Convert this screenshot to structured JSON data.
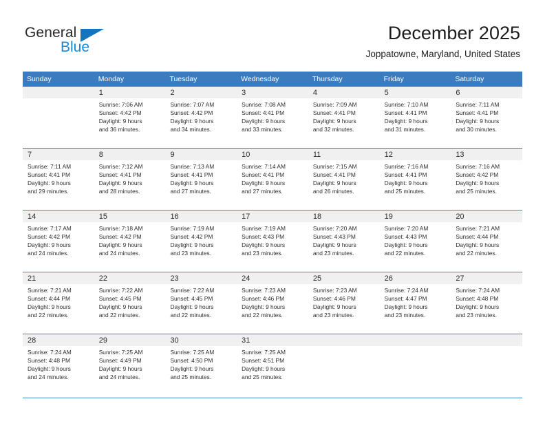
{
  "brand": {
    "name_part1": "General",
    "name_part2": "Blue",
    "triangle_color": "#1574bb",
    "blue_color": "#1b86d6"
  },
  "header": {
    "title": "December 2025",
    "subtitle": "Joppatowne, Maryland, United States"
  },
  "theme": {
    "header_row_bg": "#3b7cc0",
    "day_number_bg": "#f0f0f0",
    "row_divider": "#4a86c5"
  },
  "calendar": {
    "weekdays": [
      "Sunday",
      "Monday",
      "Tuesday",
      "Wednesday",
      "Thursday",
      "Friday",
      "Saturday"
    ],
    "weeks": [
      [
        {
          "day": "",
          "lines": []
        },
        {
          "day": "1",
          "lines": [
            "Sunrise: 7:06 AM",
            "Sunset: 4:42 PM",
            "Daylight: 9 hours",
            "and 36 minutes."
          ]
        },
        {
          "day": "2",
          "lines": [
            "Sunrise: 7:07 AM",
            "Sunset: 4:42 PM",
            "Daylight: 9 hours",
            "and 34 minutes."
          ]
        },
        {
          "day": "3",
          "lines": [
            "Sunrise: 7:08 AM",
            "Sunset: 4:41 PM",
            "Daylight: 9 hours",
            "and 33 minutes."
          ]
        },
        {
          "day": "4",
          "lines": [
            "Sunrise: 7:09 AM",
            "Sunset: 4:41 PM",
            "Daylight: 9 hours",
            "and 32 minutes."
          ]
        },
        {
          "day": "5",
          "lines": [
            "Sunrise: 7:10 AM",
            "Sunset: 4:41 PM",
            "Daylight: 9 hours",
            "and 31 minutes."
          ]
        },
        {
          "day": "6",
          "lines": [
            "Sunrise: 7:11 AM",
            "Sunset: 4:41 PM",
            "Daylight: 9 hours",
            "and 30 minutes."
          ]
        }
      ],
      [
        {
          "day": "7",
          "lines": [
            "Sunrise: 7:11 AM",
            "Sunset: 4:41 PM",
            "Daylight: 9 hours",
            "and 29 minutes."
          ]
        },
        {
          "day": "8",
          "lines": [
            "Sunrise: 7:12 AM",
            "Sunset: 4:41 PM",
            "Daylight: 9 hours",
            "and 28 minutes."
          ]
        },
        {
          "day": "9",
          "lines": [
            "Sunrise: 7:13 AM",
            "Sunset: 4:41 PM",
            "Daylight: 9 hours",
            "and 27 minutes."
          ]
        },
        {
          "day": "10",
          "lines": [
            "Sunrise: 7:14 AM",
            "Sunset: 4:41 PM",
            "Daylight: 9 hours",
            "and 27 minutes."
          ]
        },
        {
          "day": "11",
          "lines": [
            "Sunrise: 7:15 AM",
            "Sunset: 4:41 PM",
            "Daylight: 9 hours",
            "and 26 minutes."
          ]
        },
        {
          "day": "12",
          "lines": [
            "Sunrise: 7:16 AM",
            "Sunset: 4:41 PM",
            "Daylight: 9 hours",
            "and 25 minutes."
          ]
        },
        {
          "day": "13",
          "lines": [
            "Sunrise: 7:16 AM",
            "Sunset: 4:42 PM",
            "Daylight: 9 hours",
            "and 25 minutes."
          ]
        }
      ],
      [
        {
          "day": "14",
          "lines": [
            "Sunrise: 7:17 AM",
            "Sunset: 4:42 PM",
            "Daylight: 9 hours",
            "and 24 minutes."
          ]
        },
        {
          "day": "15",
          "lines": [
            "Sunrise: 7:18 AM",
            "Sunset: 4:42 PM",
            "Daylight: 9 hours",
            "and 24 minutes."
          ]
        },
        {
          "day": "16",
          "lines": [
            "Sunrise: 7:19 AM",
            "Sunset: 4:42 PM",
            "Daylight: 9 hours",
            "and 23 minutes."
          ]
        },
        {
          "day": "17",
          "lines": [
            "Sunrise: 7:19 AM",
            "Sunset: 4:43 PM",
            "Daylight: 9 hours",
            "and 23 minutes."
          ]
        },
        {
          "day": "18",
          "lines": [
            "Sunrise: 7:20 AM",
            "Sunset: 4:43 PM",
            "Daylight: 9 hours",
            "and 23 minutes."
          ]
        },
        {
          "day": "19",
          "lines": [
            "Sunrise: 7:20 AM",
            "Sunset: 4:43 PM",
            "Daylight: 9 hours",
            "and 22 minutes."
          ]
        },
        {
          "day": "20",
          "lines": [
            "Sunrise: 7:21 AM",
            "Sunset: 4:44 PM",
            "Daylight: 9 hours",
            "and 22 minutes."
          ]
        }
      ],
      [
        {
          "day": "21",
          "lines": [
            "Sunrise: 7:21 AM",
            "Sunset: 4:44 PM",
            "Daylight: 9 hours",
            "and 22 minutes."
          ]
        },
        {
          "day": "22",
          "lines": [
            "Sunrise: 7:22 AM",
            "Sunset: 4:45 PM",
            "Daylight: 9 hours",
            "and 22 minutes."
          ]
        },
        {
          "day": "23",
          "lines": [
            "Sunrise: 7:22 AM",
            "Sunset: 4:45 PM",
            "Daylight: 9 hours",
            "and 22 minutes."
          ]
        },
        {
          "day": "24",
          "lines": [
            "Sunrise: 7:23 AM",
            "Sunset: 4:46 PM",
            "Daylight: 9 hours",
            "and 22 minutes."
          ]
        },
        {
          "day": "25",
          "lines": [
            "Sunrise: 7:23 AM",
            "Sunset: 4:46 PM",
            "Daylight: 9 hours",
            "and 23 minutes."
          ]
        },
        {
          "day": "26",
          "lines": [
            "Sunrise: 7:24 AM",
            "Sunset: 4:47 PM",
            "Daylight: 9 hours",
            "and 23 minutes."
          ]
        },
        {
          "day": "27",
          "lines": [
            "Sunrise: 7:24 AM",
            "Sunset: 4:48 PM",
            "Daylight: 9 hours",
            "and 23 minutes."
          ]
        }
      ],
      [
        {
          "day": "28",
          "lines": [
            "Sunrise: 7:24 AM",
            "Sunset: 4:48 PM",
            "Daylight: 9 hours",
            "and 24 minutes."
          ]
        },
        {
          "day": "29",
          "lines": [
            "Sunrise: 7:25 AM",
            "Sunset: 4:49 PM",
            "Daylight: 9 hours",
            "and 24 minutes."
          ]
        },
        {
          "day": "30",
          "lines": [
            "Sunrise: 7:25 AM",
            "Sunset: 4:50 PM",
            "Daylight: 9 hours",
            "and 25 minutes."
          ]
        },
        {
          "day": "31",
          "lines": [
            "Sunrise: 7:25 AM",
            "Sunset: 4:51 PM",
            "Daylight: 9 hours",
            "and 25 minutes."
          ]
        },
        {
          "day": "",
          "lines": []
        },
        {
          "day": "",
          "lines": []
        },
        {
          "day": "",
          "lines": []
        }
      ]
    ]
  }
}
